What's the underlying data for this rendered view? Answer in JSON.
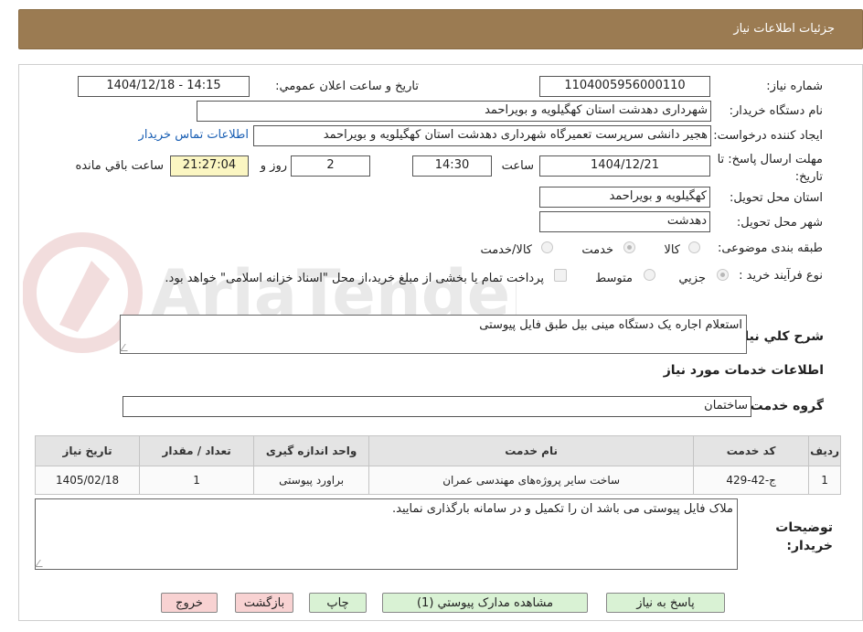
{
  "header": {
    "title": "جزئیات اطلاعات نیاز"
  },
  "fields": {
    "need_number_label": "شماره نیاز:",
    "need_number": "1104005956000110",
    "announce_label": "تاریخ و ساعت اعلان عمومي:",
    "announce_value": "1404/12/18 - 14:15",
    "buyer_label": "نام دستگاه خریدار:",
    "buyer_value": "شهرداری دهدشت استان کهگیلویه و بویراحمد",
    "requester_label": "ایجاد کننده درخواست:",
    "requester_value": "هجیر دانشی سرپرست تعمیرگاه شهرداری دهدشت استان کهگیلویه و بویراحمد",
    "contact_link": "اطلاعات تماس خریدار",
    "deadline_label": "مهلت ارسال پاسخ: تا تاریخ:",
    "deadline_date": "1404/12/21",
    "time_label": "ساعت",
    "deadline_time": "14:30",
    "days_value": "2",
    "days_label": "روز و",
    "remaining_time": "21:27:04",
    "remaining_label": "ساعت باقي مانده",
    "province_label": "استان محل تحویل:",
    "province_value": "کهگیلویه و بویراحمد",
    "city_label": "شهر محل تحویل:",
    "city_value": "دهدشت",
    "category_label": "طبقه بندی موضوعی:",
    "category_options": [
      "کالا",
      "خدمت",
      "کالا/خدمت"
    ],
    "category_selected": "خدمت",
    "process_label": "نوع فرآیند خرید :",
    "process_options": [
      "جزيي",
      "متوسط"
    ],
    "process_selected": "جزيي",
    "payment_note": "پرداخت تمام یا بخشی از مبلغ خرید،از محل \"اسناد خزانه اسلامی\" خواهد بود."
  },
  "description": {
    "label": "شرح کلي نياز:",
    "value": "استعلام اجاره یک دستگاه مینی بیل طبق فایل پیوستی"
  },
  "services": {
    "section_title": "اطلاعات خدمات مورد نیاز",
    "group_label": "گروه خدمت:",
    "group_value": "ساختمان",
    "table": {
      "headers": [
        "رديف",
        "کد خدمت",
        "نام خدمت",
        "واحد اندازه گیری",
        "تعداد / مقدار",
        "تاريخ نياز"
      ],
      "rows": [
        [
          "1",
          "ج-42-429",
          "ساخت سایر پروژه‌های مهندسی عمران",
          "براورد پیوستی",
          "1",
          "1405/02/18"
        ]
      ]
    }
  },
  "buyer_notes": {
    "label": "توضیحات خریدار:",
    "value": "ملاک فایل پیوستی می باشد ان را تکمیل و در سامانه بارگذاری نمایید."
  },
  "buttons": {
    "reply": "پاسخ به نیاز",
    "attachments": "مشاهده مدارک پیوستي (1)",
    "print": "چاپ",
    "back": "بازگشت",
    "exit": "خروج"
  },
  "watermark": {
    "text": "AriaTender.neT"
  },
  "colors": {
    "header_bg": "#9b7b52",
    "link": "#1a5fb4",
    "button_green": "#d9f2d4",
    "button_pink": "#f8d2d2"
  }
}
